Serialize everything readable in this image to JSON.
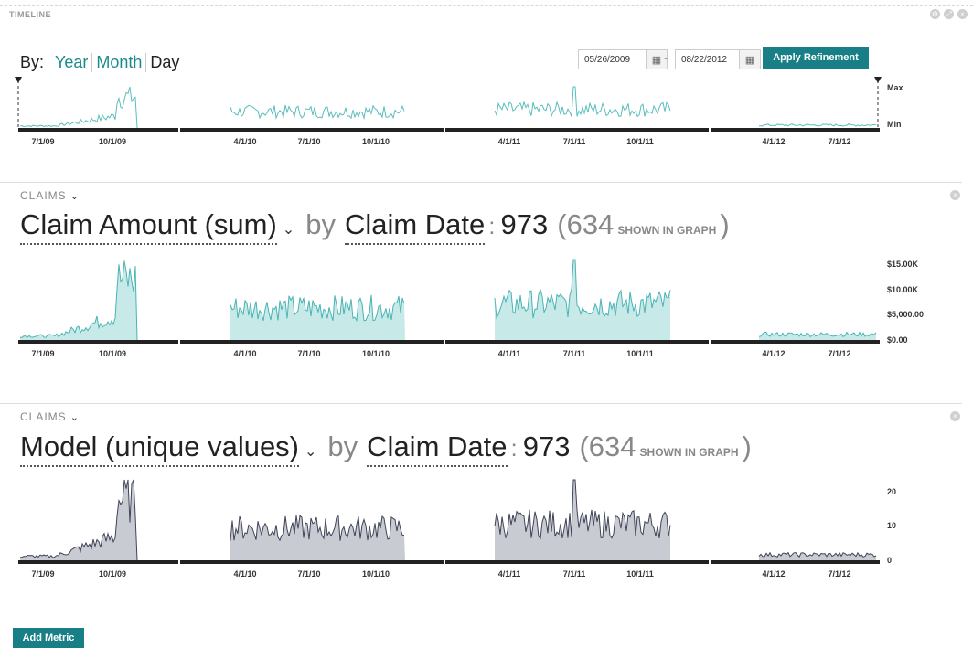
{
  "timeline": {
    "title": "TIMELINE",
    "by_label": "By:",
    "granularity": [
      "Year",
      "Month",
      "Day"
    ],
    "active_granularity": "Month",
    "start_date": "05/26/2009",
    "end_date": "08/22/2012",
    "date_separator": "-",
    "apply_label": "Apply Refinement",
    "max_label": "Max",
    "min_label": "Min",
    "x_tick_labels": [
      "7/1/09",
      "10/1/09",
      "4/1/10",
      "7/1/10",
      "10/1/10",
      "4/1/11",
      "7/1/11",
      "10/1/11",
      "4/1/12",
      "7/1/12"
    ]
  },
  "panels": [
    {
      "section": "CLAIMS",
      "metric": "Claim Amount (sum)",
      "by": "by",
      "dimension": "Claim Date",
      "colon": ":",
      "count": "973",
      "shown_count": "634",
      "shown_label": "SHOWN IN GRAPH",
      "y_labels": [
        "$15.00K",
        "$10.00K",
        "$5,000.00",
        "$0.00"
      ],
      "color": "#5bbdbd"
    },
    {
      "section": "CLAIMS",
      "metric": "Model (unique values)",
      "by": "by",
      "dimension": "Claim Date",
      "colon": ":",
      "count": "973",
      "shown_count": "634",
      "shown_label": "SHOWN IN GRAPH",
      "y_labels": [
        "20",
        "10",
        "0"
      ],
      "color": "#4a4e63"
    }
  ],
  "add_metric_label": "Add Metric",
  "chart_data": [
    {
      "type": "area",
      "title": "Timeline",
      "x_ticks": [
        "7/1/09",
        "10/1/09",
        "4/1/10",
        "7/1/10",
        "10/1/10",
        "4/1/11",
        "7/1/11",
        "10/1/11",
        "4/1/12",
        "7/1/12"
      ],
      "segments": [
        {
          "range": [
            "5/26/09",
            "11/15/09"
          ],
          "level": "low rising to peak near 11/1/09"
        },
        {
          "range": [
            "3/1/10",
            "12/31/10"
          ],
          "level": "medium"
        },
        {
          "range": [
            "3/1/11",
            "11/30/11"
          ],
          "level": "medium, peak near 7/1/11"
        },
        {
          "range": [
            "3/1/12",
            "8/22/12"
          ],
          "level": "low"
        }
      ],
      "y_labels": [
        "Max",
        "Min"
      ]
    },
    {
      "type": "area",
      "title": "Claim Amount (sum) by Claim Date",
      "ylim": [
        0,
        15000
      ],
      "y_ticks": [
        "$0.00",
        "$5,000.00",
        "$10.00K",
        "$15.00K"
      ],
      "x_ticks": [
        "7/1/09",
        "10/1/09",
        "4/1/10",
        "7/1/10",
        "10/1/10",
        "4/1/11",
        "7/1/11",
        "10/1/11",
        "4/1/12",
        "7/1/12"
      ],
      "approx_peaks": {
        "10/1/09": 12000,
        "7/1/10": 10000,
        "7/1/11": 16000,
        "4/1/12": 2000
      }
    },
    {
      "type": "area",
      "title": "Model (unique values) by Claim Date",
      "ylim": [
        0,
        25
      ],
      "y_ticks": [
        "0",
        "10",
        "20"
      ],
      "x_ticks": [
        "7/1/09",
        "10/1/09",
        "4/1/10",
        "7/1/10",
        "10/1/10",
        "4/1/11",
        "7/1/11",
        "10/1/11",
        "4/1/12",
        "7/1/12"
      ],
      "approx_peaks": {
        "10/1/09": 19,
        "7/1/10": 18,
        "7/1/11": 24,
        "4/1/12": 3
      }
    }
  ]
}
